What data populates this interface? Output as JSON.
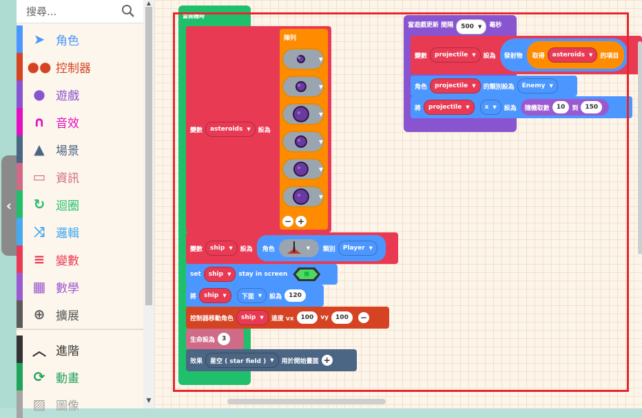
{
  "search": {
    "placeholder": "搜尋..."
  },
  "categories": [
    {
      "label": "角色",
      "color": "#4c97ff",
      "icon": "paper-plane-icon"
    },
    {
      "label": "控制器",
      "color": "#d54322",
      "icon": "gamepad-icon"
    },
    {
      "label": "遊戲",
      "color": "#8854d0",
      "icon": "circle-icon"
    },
    {
      "label": "音效",
      "color": "#e30fc0",
      "icon": "headphones-icon"
    },
    {
      "label": "場景",
      "color": "#4b6584",
      "icon": "tree-icon"
    },
    {
      "label": "資訊",
      "color": "#cf6a87",
      "icon": "id-card-icon"
    },
    {
      "label": "迴圈",
      "color": "#20bf6b",
      "icon": "refresh-icon"
    },
    {
      "label": "邏輯",
      "color": "#45aaf2",
      "icon": "shuffle-icon"
    },
    {
      "label": "變數",
      "color": "#e93a54",
      "icon": "list-icon"
    },
    {
      "label": "數學",
      "color": "#9b59d0",
      "icon": "calculator-icon"
    },
    {
      "label": "擴展",
      "color": "#5a5a5a",
      "icon": "plus-circle-icon"
    },
    {
      "label": "進階",
      "color": "#333333",
      "icon": "chevron-up-icon"
    },
    {
      "label": "動畫",
      "color": "#21a35b",
      "icon": "sync-icon"
    },
    {
      "label": "圖像",
      "color": "#a6a6a6",
      "icon": "image-icon"
    }
  ],
  "blocks": {
    "on_start": {
      "label": "當開機時"
    },
    "set_asteroids": {
      "var_label": "變數",
      "var_name": "asteroids",
      "set_label": "設為",
      "array_label": "陣列"
    },
    "set_ship": {
      "var_label": "變數",
      "var_name": "ship",
      "set_label": "設為",
      "sprite_label": "角色",
      "kind_label": "類別",
      "kind_value": "Player"
    },
    "stay_in_screen": {
      "set_label": "set",
      "var_name": "ship",
      "prop": "stay in screen",
      "toggle": "開"
    },
    "set_bottom": {
      "label": "將",
      "var_name": "ship",
      "prop": "下面",
      "set_label": "設為",
      "value": "120"
    },
    "move_control": {
      "label": "控制器移動角色",
      "var_name": "ship",
      "speed_label": "速度 vx",
      "vx": "100",
      "vy_label": "vy",
      "vy": "100"
    },
    "set_life": {
      "label": "生命設為",
      "value": "3"
    },
    "effect": {
      "label": "效果",
      "effect_name": "星空 ( star field )",
      "suffix": "用於開始畫面"
    },
    "on_update": {
      "label": "當遊戲更新 間隔",
      "interval": "500",
      "unit": "毫秒"
    },
    "set_projectile": {
      "var_label": "變數",
      "var_name": "projectile",
      "set_label": "設為",
      "proj_label": "發射物",
      "get_label": "取得",
      "array_name": "asteroids",
      "suffix": "的項目"
    },
    "set_kind": {
      "label": "角色",
      "var_name": "projectile",
      "mid": "的類別設為",
      "kind": "Enemy"
    },
    "set_x": {
      "label": "將",
      "var_name": "projectile",
      "prop": "x",
      "set_label": "設為",
      "rand_label": "隨機取數",
      "from": "10",
      "to_label": "到",
      "to": "150"
    }
  },
  "colors": {
    "highlight": "#e6252d",
    "loops": "#20bf6b",
    "variables": "#e93a54",
    "arrays": "#ff8c00",
    "sprites": "#4c97ff",
    "controller": "#d54322",
    "info": "#cf6a87",
    "scene": "#4b6584",
    "game": "#8854d0"
  }
}
